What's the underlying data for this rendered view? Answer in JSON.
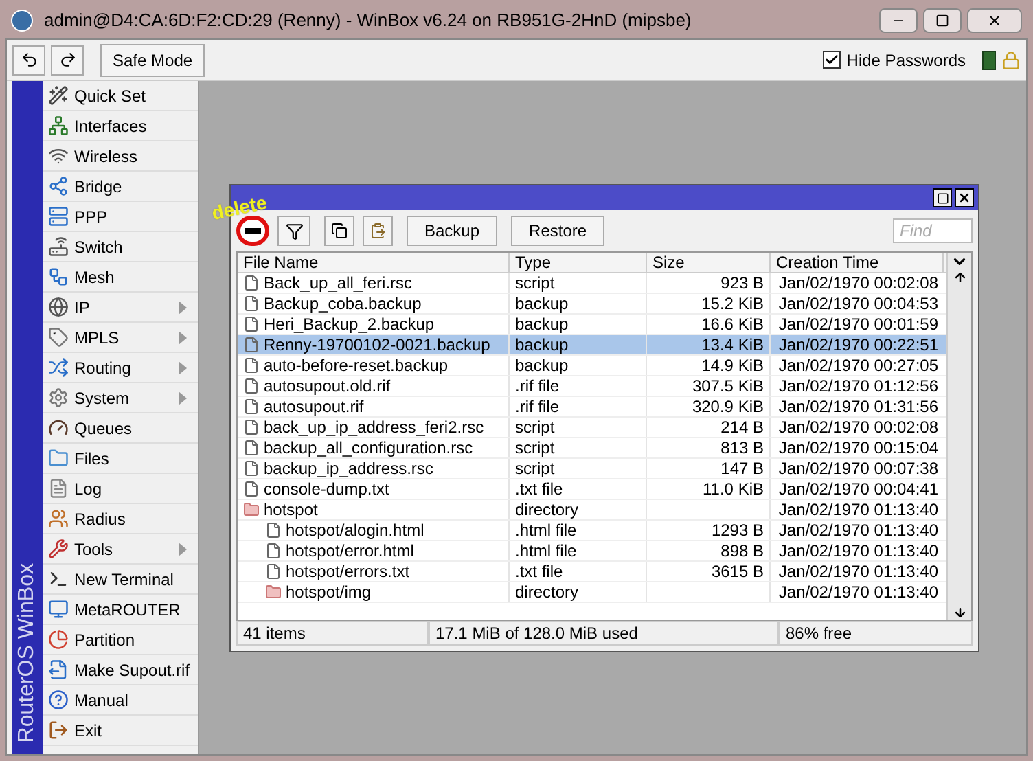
{
  "window": {
    "title": "admin@D4:CA:6D:F2:CD:29 (Renny) - WinBox v6.24 on RB951G-2HnD (mipsbe)"
  },
  "toolbar": {
    "safe_mode": "Safe Mode",
    "hide_passwords": {
      "label": "Hide Passwords",
      "checked": true
    }
  },
  "sidebar": {
    "brand": "RouterOS WinBox",
    "items": [
      {
        "label": "Quick Set",
        "has_submenu": false
      },
      {
        "label": "Interfaces",
        "has_submenu": false
      },
      {
        "label": "Wireless",
        "has_submenu": false
      },
      {
        "label": "Bridge",
        "has_submenu": false
      },
      {
        "label": "PPP",
        "has_submenu": false
      },
      {
        "label": "Switch",
        "has_submenu": false
      },
      {
        "label": "Mesh",
        "has_submenu": false
      },
      {
        "label": "IP",
        "has_submenu": true
      },
      {
        "label": "MPLS",
        "has_submenu": true
      },
      {
        "label": "Routing",
        "has_submenu": true
      },
      {
        "label": "System",
        "has_submenu": true
      },
      {
        "label": "Queues",
        "has_submenu": false
      },
      {
        "label": "Files",
        "has_submenu": false
      },
      {
        "label": "Log",
        "has_submenu": false
      },
      {
        "label": "Radius",
        "has_submenu": false
      },
      {
        "label": "Tools",
        "has_submenu": true
      },
      {
        "label": "New Terminal",
        "has_submenu": false
      },
      {
        "label": "MetaROUTER",
        "has_submenu": false
      },
      {
        "label": "Partition",
        "has_submenu": false
      },
      {
        "label": "Make Supout.rif",
        "has_submenu": false
      },
      {
        "label": "Manual",
        "has_submenu": false
      },
      {
        "label": "Exit",
        "has_submenu": false
      }
    ]
  },
  "file_window": {
    "annotation": "delete",
    "buttons": [
      "Backup",
      "Restore"
    ],
    "search": {
      "placeholder": "Find"
    },
    "table": {
      "columns": [
        "File Name",
        "Type",
        "Size",
        "Creation Time"
      ],
      "rows": [
        {
          "kind": "file",
          "name": "Back_up_all_feri.rsc",
          "type": "script",
          "size": "923 B",
          "time": "Jan/02/1970 00:02:08",
          "selected": false
        },
        {
          "kind": "file",
          "name": "Backup_coba.backup",
          "type": "backup",
          "size": "15.2 KiB",
          "time": "Jan/02/1970 00:04:53",
          "selected": false
        },
        {
          "kind": "file",
          "name": "Heri_Backup_2.backup",
          "type": "backup",
          "size": "16.6 KiB",
          "time": "Jan/02/1970 00:01:59",
          "selected": false
        },
        {
          "kind": "file",
          "name": "Renny-19700102-0021.backup",
          "type": "backup",
          "size": "13.4 KiB",
          "time": "Jan/02/1970 00:22:51",
          "selected": true
        },
        {
          "kind": "file",
          "name": "auto-before-reset.backup",
          "type": "backup",
          "size": "14.9 KiB",
          "time": "Jan/02/1970 00:27:05",
          "selected": false
        },
        {
          "kind": "file",
          "name": "autosupout.old.rif",
          "type": ".rif file",
          "size": "307.5 KiB",
          "time": "Jan/02/1970 01:12:56",
          "selected": false
        },
        {
          "kind": "file",
          "name": "autosupout.rif",
          "type": ".rif file",
          "size": "320.9 KiB",
          "time": "Jan/02/1970 01:31:56",
          "selected": false
        },
        {
          "kind": "file",
          "name": "back_up_ip_address_feri2.rsc",
          "type": "script",
          "size": "214 B",
          "time": "Jan/02/1970 00:02:08",
          "selected": false
        },
        {
          "kind": "file",
          "name": "backup_all_configuration.rsc",
          "type": "script",
          "size": "813 B",
          "time": "Jan/02/1970 00:15:04",
          "selected": false
        },
        {
          "kind": "file",
          "name": "backup_ip_address.rsc",
          "type": "script",
          "size": "147 B",
          "time": "Jan/02/1970 00:07:38",
          "selected": false
        },
        {
          "kind": "file",
          "name": "console-dump.txt",
          "type": ".txt file",
          "size": "11.0 KiB",
          "time": "Jan/02/1970 00:04:41",
          "selected": false
        },
        {
          "kind": "directory",
          "name": "hotspot",
          "type": "directory",
          "time": "Jan/02/1970 01:13:40",
          "selected": false,
          "children": [
            {
              "kind": "file",
              "name": "hotspot/alogin.html",
              "type": ".html file",
              "size": "1293 B",
              "time": "Jan/02/1970 01:13:40",
              "selected": false
            },
            {
              "kind": "file",
              "name": "hotspot/error.html",
              "type": ".html file",
              "size": "898 B",
              "time": "Jan/02/1970 01:13:40",
              "selected": false
            },
            {
              "kind": "file",
              "name": "hotspot/errors.txt",
              "type": ".txt file",
              "size": "3615 B",
              "time": "Jan/02/1970 01:13:40",
              "selected": false
            },
            {
              "kind": "directory",
              "name": "hotspot/img",
              "type": "directory",
              "time": "Jan/02/1970 01:13:40",
              "selected": false
            }
          ]
        }
      ]
    },
    "status_bar": [
      "41 items",
      "17.1 MiB of 128.0 MiB used",
      "86% free"
    ]
  }
}
